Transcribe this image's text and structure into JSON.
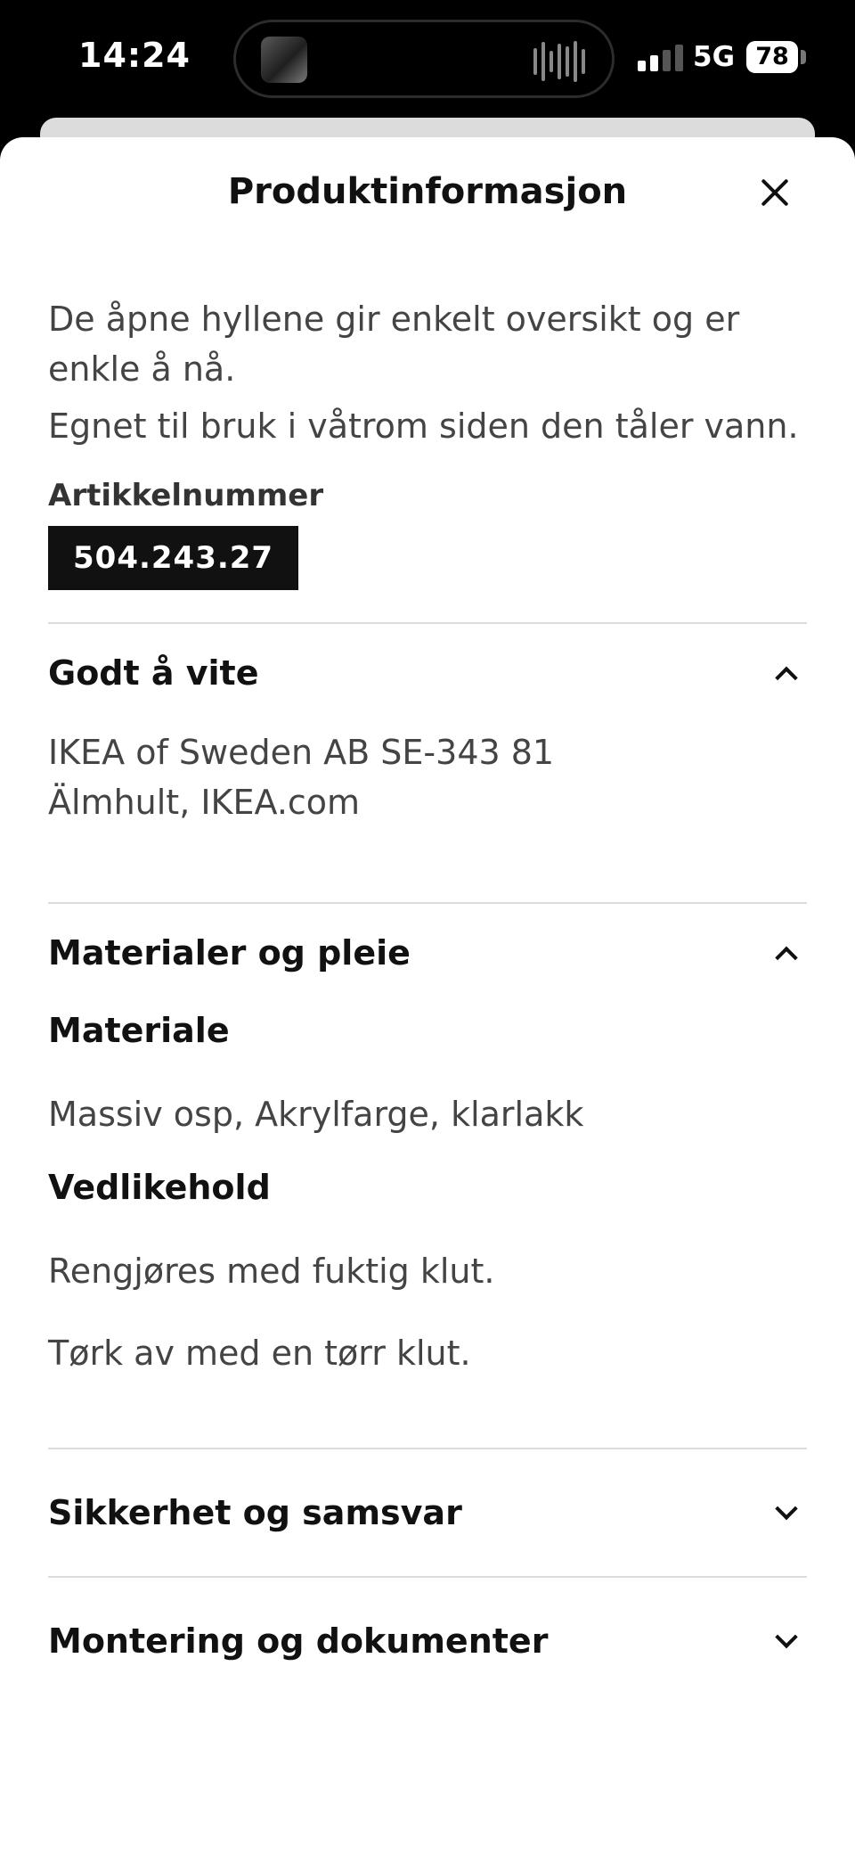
{
  "status_bar": {
    "time": "14:24",
    "network": "5G",
    "battery": "78"
  },
  "sheet": {
    "title": "Produktinformasjon",
    "close_icon": "close-icon"
  },
  "description": {
    "line1": "De åpne hyllene gir enkelt oversikt og er enkle å nå.",
    "line2": "Egnet til bruk i våtrom siden den tåler vann."
  },
  "article": {
    "label": "Artikkelnummer",
    "number": "504.243.27"
  },
  "sections": {
    "good_to_know": {
      "title": "Godt å vite",
      "expanded": true,
      "text_line1": "IKEA of Sweden AB SE-343 81",
      "text_line2": "Älmhult, IKEA.com"
    },
    "materials": {
      "title": "Materialer og pleie",
      "expanded": true,
      "material_heading": "Materiale",
      "material_text": "Massiv osp, Akrylfarge, klarlakk",
      "care_heading": "Vedlikehold",
      "care_line1": "Rengjøres med fuktig klut.",
      "care_line2": "Tørk av med en tørr klut."
    },
    "safety": {
      "title": "Sikkerhet og samsvar",
      "expanded": false
    },
    "assembly": {
      "title": "Montering og dokumenter",
      "expanded": false
    }
  }
}
